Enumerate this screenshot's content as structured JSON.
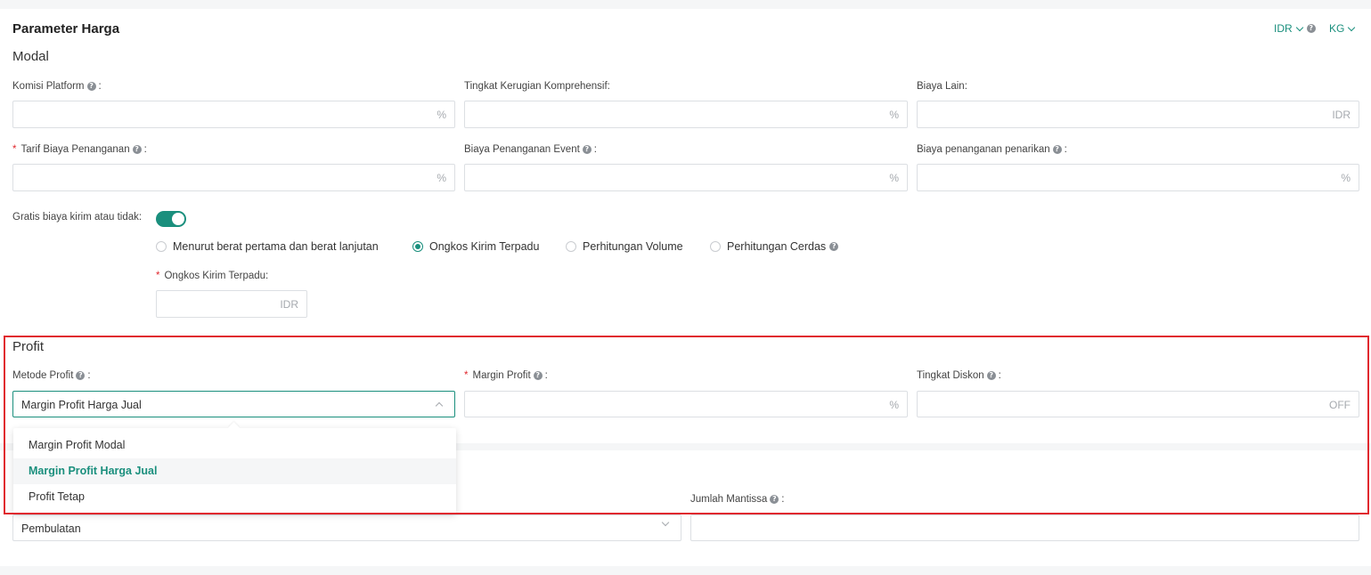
{
  "header": {
    "title": "Parameter Harga",
    "currency_label": "IDR",
    "weight_label": "KG"
  },
  "modal": {
    "heading": "Modal",
    "fields": {
      "komisi_platform": {
        "label": "Komisi Platform",
        "suffix": "%"
      },
      "tingkat_kerugian": {
        "label": "Tingkat Kerugian Komprehensif:",
        "suffix": "%"
      },
      "biaya_lain": {
        "label": "Biaya Lain:",
        "suffix": "IDR"
      },
      "tarif_biaya_penanganan": {
        "label": "Tarif Biaya Penanganan",
        "suffix": "%"
      },
      "biaya_penanganan_event": {
        "label": "Biaya Penanganan Event",
        "suffix": "%"
      },
      "biaya_penanganan_penarikan": {
        "label": "Biaya penanganan penarikan",
        "suffix": "%"
      }
    },
    "free_shipping_label": "Gratis biaya kirim atau tidak:",
    "free_shipping_on": true,
    "shipping_options": [
      {
        "label": "Menurut berat pertama dan berat lanjutan",
        "selected": false
      },
      {
        "label": "Ongkos Kirim Terpadu",
        "selected": true
      },
      {
        "label": "Perhitungan Volume",
        "selected": false
      },
      {
        "label": "Perhitungan Cerdas",
        "selected": false
      }
    ],
    "ongkos_kirim": {
      "label": "Ongkos Kirim Terpadu:",
      "suffix": "IDR"
    }
  },
  "profit": {
    "heading": "Profit",
    "metode_profit": {
      "label": "Metode Profit",
      "value": "Margin Profit Harga Jual"
    },
    "margin_profit": {
      "label": "Margin Profit",
      "suffix": "%"
    },
    "tingkat_diskon": {
      "label": "Tingkat Diskon",
      "suffix": "OFF"
    },
    "dropdown_options": [
      {
        "label": "Margin Profit Modal",
        "selected": false
      },
      {
        "label": "Margin Profit Harga Jual",
        "selected": true
      },
      {
        "label": "Profit Tetap",
        "selected": false
      }
    ]
  },
  "rounding": {
    "jumlah_mantissa_label": "Jumlah Mantissa",
    "rounding_value": "Pembulatan"
  },
  "colors": {
    "accent": "#1a8f7d",
    "required": "#e0282e",
    "highlight": "#e0282e"
  }
}
